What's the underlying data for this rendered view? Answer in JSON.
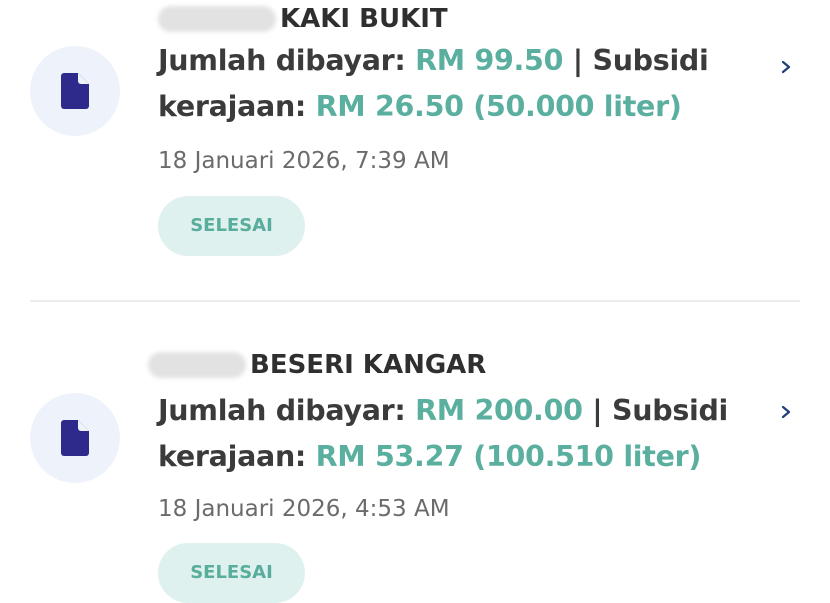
{
  "transactions": [
    {
      "station_name": "KAKI BUKIT",
      "paid_label": "Jumlah dibayar:",
      "paid_amount": "RM 99.50",
      "separator": " | ",
      "subsidy_label_1": "Subsidi",
      "subsidy_label_2": "kerajaan:",
      "subsidy_amount": "RM 26.50",
      "volume": "(50.000 liter)",
      "datetime": "18 Januari 2026, 7:39 AM",
      "status": "SELESAI",
      "icon": "document-icon"
    },
    {
      "station_name": "BESERI KANGAR",
      "paid_label": "Jumlah dibayar:",
      "paid_amount": "RM 200.00",
      "separator": " | ",
      "subsidy_label_1": "Subsidi",
      "subsidy_label_2": "kerajaan:",
      "subsidy_amount": "RM 53.27",
      "volume": "(100.510 liter)",
      "datetime": "18 Januari 2026, 4:53 AM",
      "status": "SELESAI",
      "icon": "document-icon"
    }
  ],
  "colors": {
    "accent_teal": "#5aaf9f",
    "badge_bg": "#dff1ee",
    "icon_bg": "#eef3fb",
    "icon_fg": "#2e2a8c",
    "chevron": "#1f3f7a"
  }
}
